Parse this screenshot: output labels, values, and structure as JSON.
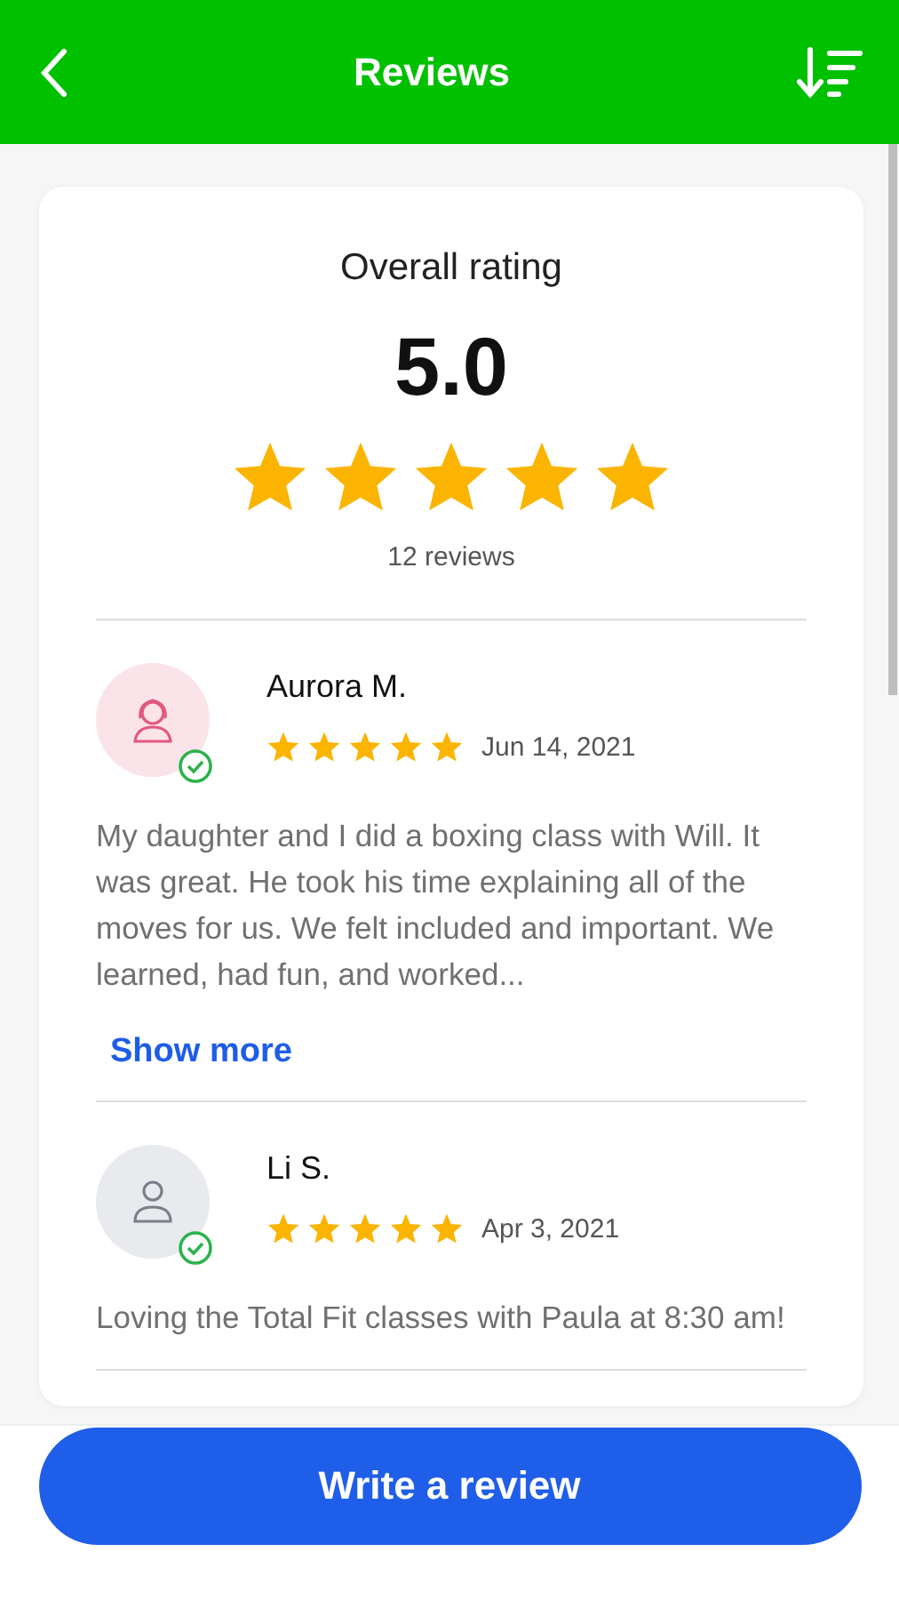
{
  "header": {
    "title": "Reviews"
  },
  "summary": {
    "heading": "Overall rating",
    "score": "5.0",
    "stars": 5,
    "count": "12 reviews"
  },
  "reviews": [
    {
      "name": "Aurora M.",
      "kind": "female",
      "verified": true,
      "stars": 5,
      "date": "Jun 14, 2021",
      "text": "My daughter and I did a boxing class with Will. It was great. He took his time explaining all of the moves for us. We felt included and important. We learned, had fun, and worked...",
      "show_more": "Show more"
    },
    {
      "name": "Li S.",
      "kind": "person",
      "verified": true,
      "stars": 5,
      "date": "Apr 3, 2021",
      "text": "Loving the Total Fit classes with Paula at 8:30 am!"
    }
  ],
  "footer": {
    "button": "Write a review"
  }
}
